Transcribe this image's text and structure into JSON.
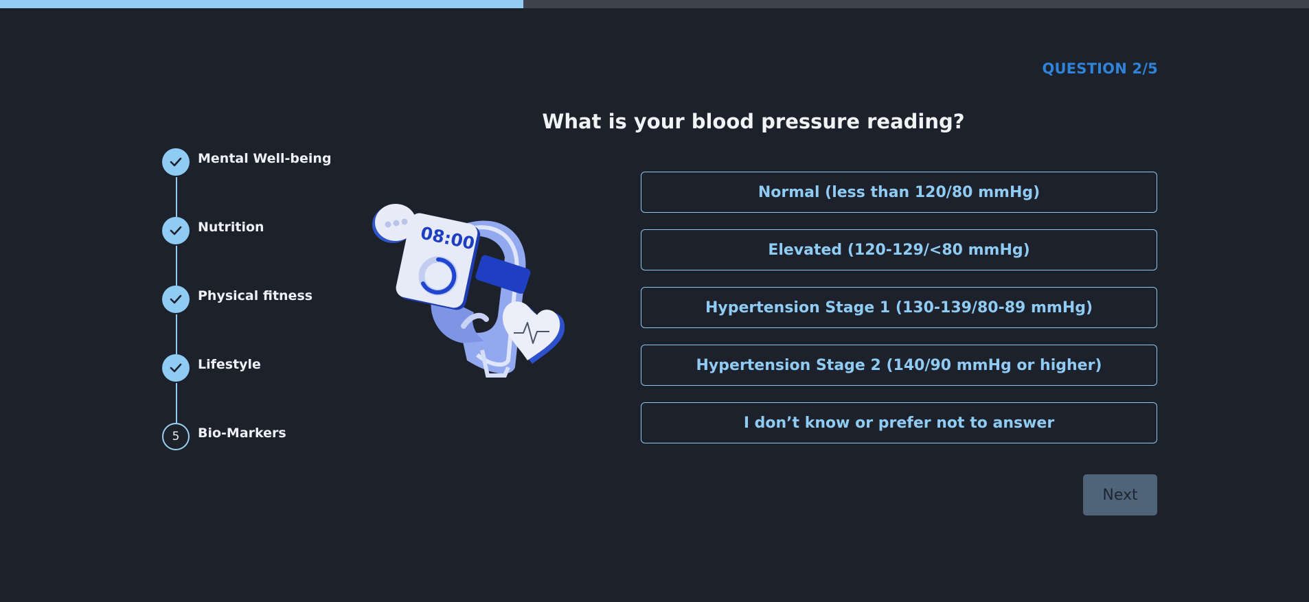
{
  "progress": {
    "fraction": 0.4,
    "colors": {
      "fill": "#93cdf3",
      "track": "#3f434e"
    }
  },
  "question": {
    "counter": "QUESTION 2/5",
    "title": "What is your blood pressure reading?"
  },
  "steps": [
    {
      "label": "Mental Well-being",
      "status": "done",
      "icon": "check-icon"
    },
    {
      "label": "Nutrition",
      "status": "done",
      "icon": "check-icon"
    },
    {
      "label": "Physical fitness",
      "status": "done",
      "icon": "check-icon"
    },
    {
      "label": "Lifestyle",
      "status": "done",
      "icon": "check-icon"
    },
    {
      "label": "Bio-Markers",
      "status": "current",
      "number": "5"
    }
  ],
  "illustration": {
    "watch_time": "08:00",
    "icon": "smartwatch-heart-illustration"
  },
  "options": [
    "Normal (less than 120/80 mmHg)",
    "Elevated (120-129/<80 mmHg)",
    "Hypertension Stage 1 (130-139/80-89 mmHg)",
    "Hypertension Stage 2 (140/90 mmHg or higher)",
    "I don’t know or prefer not to answer"
  ],
  "actions": {
    "next_label": "Next"
  },
  "theme": {
    "background": "#1c212c",
    "accent": "#8fcbf3",
    "counter_color": "#2f83d8",
    "button_disabled": "#4f6479"
  }
}
